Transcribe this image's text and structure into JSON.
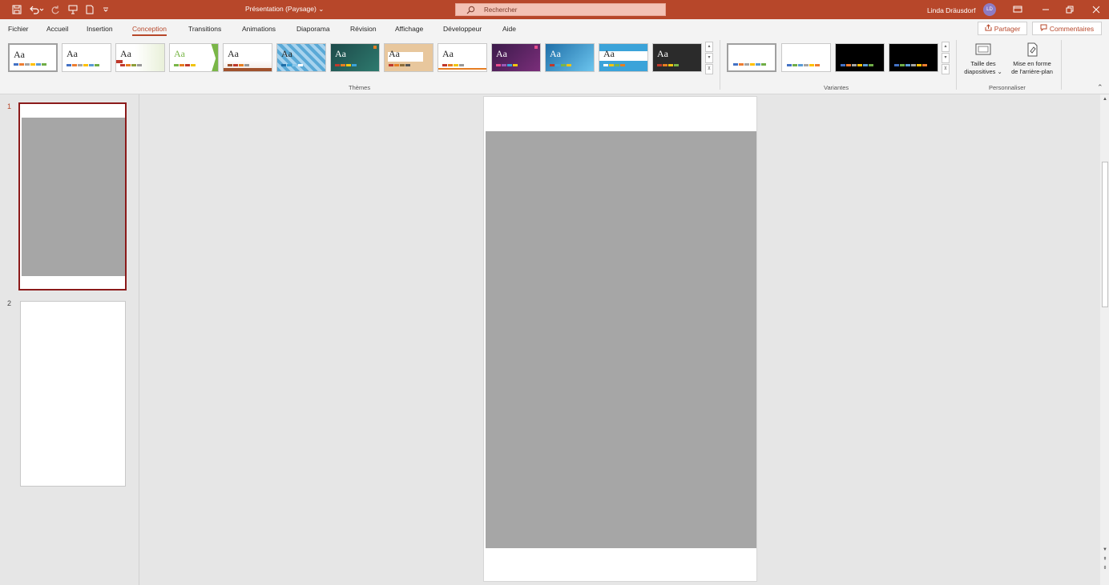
{
  "titlebar": {
    "doc_title": "Présentation (Paysage)  ⌄",
    "search_placeholder": "Rechercher",
    "user_name": "Linda Dräusdorf",
    "user_initials": "LD",
    "accent": "#b7472a"
  },
  "qat": {
    "save_icon": "save-icon",
    "undo_icon": "undo-icon",
    "redo_icon": "redo-icon",
    "present_icon": "present-icon",
    "new_icon": "new-file-icon",
    "customize_icon": "customize-icon"
  },
  "tabs": [
    {
      "label": "Fichier"
    },
    {
      "label": "Accueil"
    },
    {
      "label": "Insertion"
    },
    {
      "label": "Conception"
    },
    {
      "label": "Transitions"
    },
    {
      "label": "Animations"
    },
    {
      "label": "Diaporama"
    },
    {
      "label": "Révision"
    },
    {
      "label": "Affichage"
    },
    {
      "label": "Développeur"
    },
    {
      "label": "Aide"
    }
  ],
  "active_tab": "Conception",
  "actions": {
    "share_label": "Partager",
    "comments_label": "Commentaires"
  },
  "ribbon": {
    "themes_label": "Thèmes",
    "variants_label": "Variantes",
    "customize_label": "Personnaliser",
    "theme_aa": "Aa",
    "slide_size_line1": "Taille des",
    "slide_size_line2": "diapositives ⌄",
    "format_bg_line1": "Mise en forme",
    "format_bg_line2": "de l'arrière-plan"
  },
  "slides": [
    {
      "number": "1"
    },
    {
      "number": "2"
    }
  ]
}
